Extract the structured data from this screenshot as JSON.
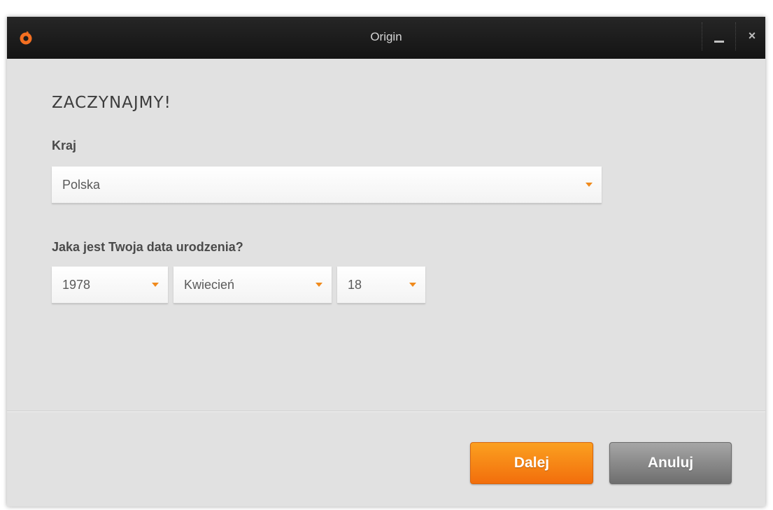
{
  "window": {
    "title": "Origin",
    "close_glyph": "×"
  },
  "icons": {
    "logo": "origin-logo-icon",
    "minimize": "minimize-icon",
    "close": "close-icon",
    "dropdown": "chevron-down-icon"
  },
  "colors": {
    "accent": "#f08a1c",
    "titlebar": "#1c1c1c",
    "background": "#e1e1e1",
    "primary_button": "#f7861a",
    "secondary_button": "#8a8a8a"
  },
  "form": {
    "heading": "ZACZYNAJMY!",
    "country_label": "Kraj",
    "country_value": "Polska",
    "birthdate_label": "Jaka jest Twoja data urodzenia?",
    "year_value": "1978",
    "month_value": "Kwiecień",
    "day_value": "18"
  },
  "buttons": {
    "next_label": "Dalej",
    "cancel_label": "Anuluj"
  }
}
